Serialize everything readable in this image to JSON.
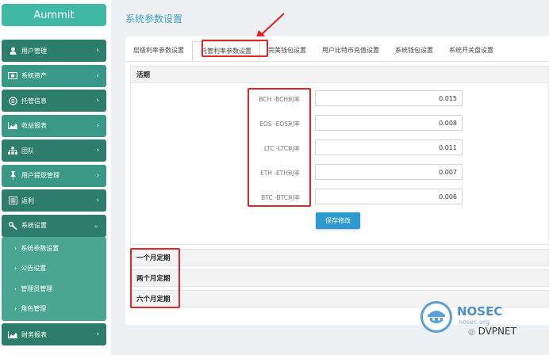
{
  "app": {
    "logo": "Aummit"
  },
  "sidebar": {
    "items": [
      {
        "label": "用户管理",
        "icon": "user-icon"
      },
      {
        "label": "系统资产",
        "icon": "money-icon"
      },
      {
        "label": "托管信息",
        "icon": "bitcoin-icon"
      },
      {
        "label": "收益报表",
        "icon": "area-chart-icon"
      },
      {
        "label": "团队",
        "icon": "sitemap-icon"
      },
      {
        "label": "用户提现管理",
        "icon": "thumbtack-icon"
      },
      {
        "label": "返利",
        "icon": "list-icon"
      },
      {
        "label": "系统设置",
        "icon": "wrench-icon"
      },
      {
        "label": "财务报表",
        "icon": "area-chart-icon"
      }
    ],
    "submenu": [
      "系统参数设置",
      "公告设置",
      "管理员管理",
      "角色管理"
    ]
  },
  "main": {
    "title": "系统参数设置",
    "tabs": [
      "层级利率参数设置",
      "托管利率参数设置",
      "完美钱包设置",
      "用户比特币充值设置",
      "系统钱包设置",
      "系统开关盘设置"
    ],
    "sections": {
      "current": "活期",
      "one_month": "一个月定期",
      "two_month": "两个月定期",
      "six_month": "六个月定期"
    },
    "fields": [
      {
        "label": "BCH -BCH利率",
        "value": "0.015"
      },
      {
        "label": "EOS -EOS利率",
        "value": "0.008"
      },
      {
        "label": "LTC -LTC利率",
        "value": "0.011"
      },
      {
        "label": "ETH -ETH利率",
        "value": "0.007"
      },
      {
        "label": "BTC -BTC利率",
        "value": "0.006"
      }
    ],
    "save_label": "保存修改"
  },
  "watermark": {
    "brand": "NOSEC",
    "domain": "nosec.org",
    "account": "DVPNET"
  },
  "colors": {
    "accent": "#3fb8a4",
    "sidebar_dark": "#2d7d6c",
    "title_blue": "#3fa1c8",
    "button_blue": "#2e9ad0",
    "annotation_red": "#e02626"
  }
}
